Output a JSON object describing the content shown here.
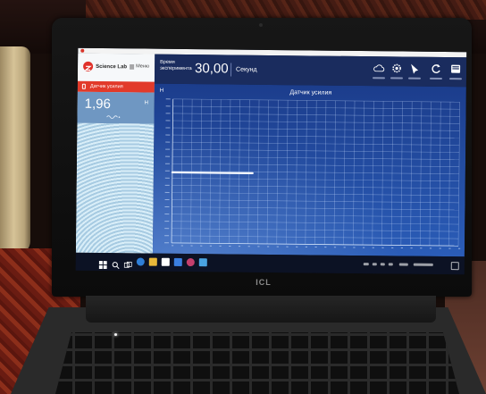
{
  "app": {
    "name": "Science Lab",
    "menu_label": "Меню"
  },
  "sidebar": {
    "sensor_label": "Датчик усилия",
    "value": "1,96",
    "unit": "Н"
  },
  "header": {
    "time_label_1": "Время",
    "time_label_2": "эксперимента",
    "time_value": "30,00",
    "time_unit": "Секунд"
  },
  "laptop": {
    "brand": "ICL"
  },
  "icons": {
    "toolbar": [
      "cloud-icon",
      "settings-icon",
      "pen-icon",
      "refresh-icon",
      "tablet-icon"
    ],
    "taskbar": [
      "windows-icon",
      "search-icon",
      "task-view-icon",
      "edge-icon",
      "folder-icon",
      "store-icon",
      "science-lab-icon"
    ]
  },
  "colors": {
    "header": "#1a2c5e",
    "chart_background": "#2453a6",
    "accent_red": "#e23a2a",
    "value_block": "#6f97c2",
    "series": "#ffffff"
  },
  "chart_data": {
    "type": "line",
    "title": "Датчик усилия",
    "xlabel": "",
    "ylabel": "Н",
    "xlim": [
      0,
      30
    ],
    "ylim": [
      0,
      4
    ],
    "xtick_step": 1,
    "ytick_step": 0.2,
    "grid": true,
    "series": [
      {
        "x": [
          0,
          8.4
        ],
        "y": [
          1.96,
          1.96
        ],
        "color": "#ffffff"
      }
    ]
  }
}
